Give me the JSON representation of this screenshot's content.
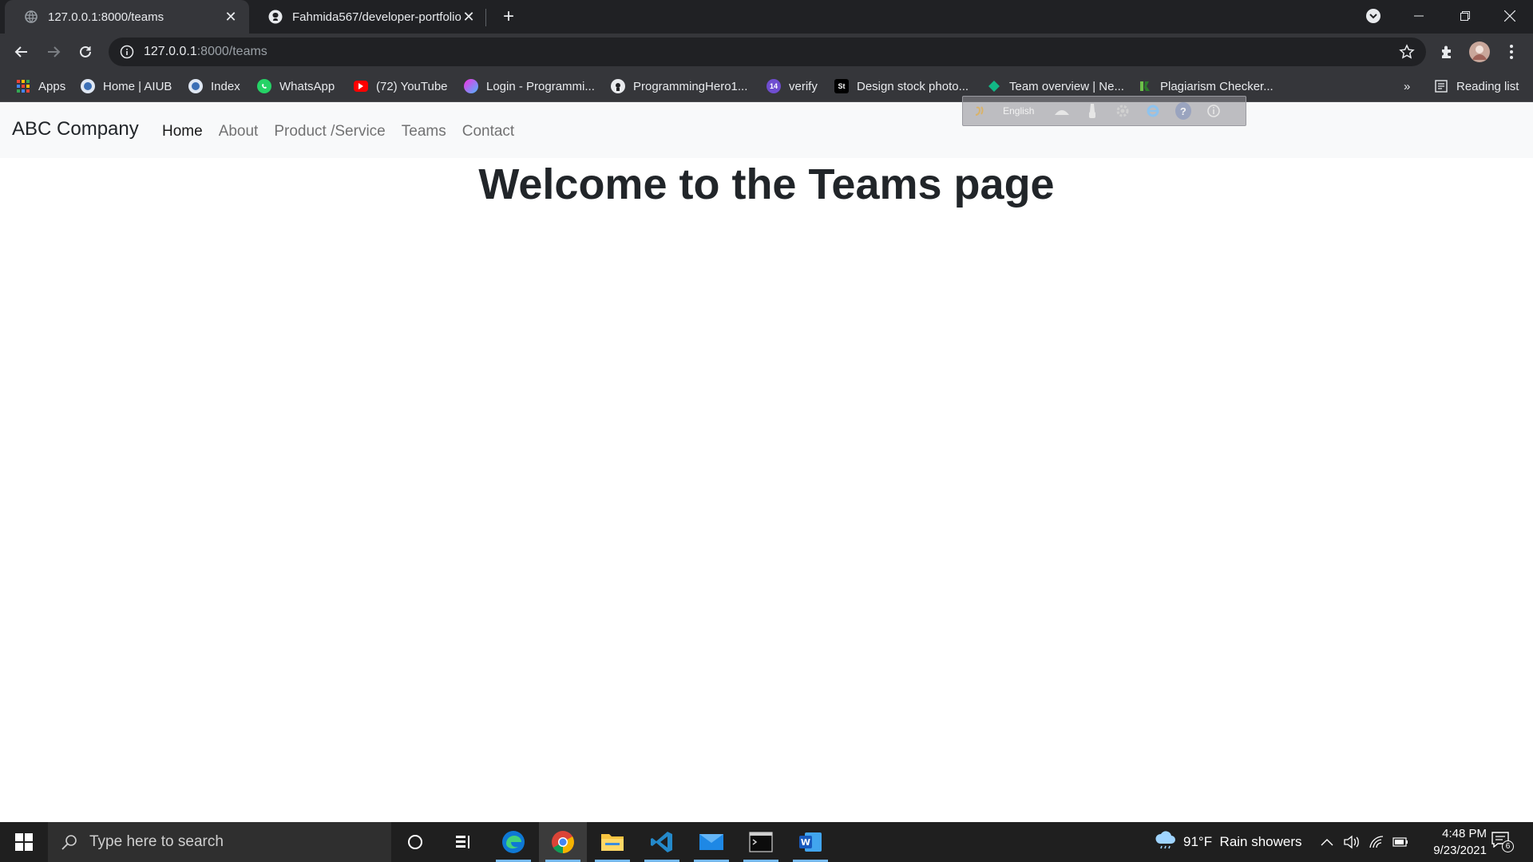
{
  "browser": {
    "tabs": [
      {
        "title": "127.0.0.1:8000/teams",
        "active": true
      },
      {
        "title": "Fahmida567/developer-portfolio",
        "active": false
      }
    ],
    "url": {
      "host": "127.0.0.1",
      "path": ":8000/teams"
    },
    "bookmarks": [
      {
        "label": "Apps",
        "icon": "apps-grid-icon"
      },
      {
        "label": "Home | AIUB",
        "icon": "aiub-icon"
      },
      {
        "label": "Index",
        "icon": "aiub-icon"
      },
      {
        "label": "WhatsApp",
        "icon": "whatsapp-icon"
      },
      {
        "label": "(72) YouTube",
        "icon": "youtube-icon"
      },
      {
        "label": "Login - Programmi...",
        "icon": "programming-hero-icon"
      },
      {
        "label": "ProgrammingHero1...",
        "icon": "github-icon"
      },
      {
        "label": "verify",
        "icon": "verify-icon"
      },
      {
        "label": "Design stock photo...",
        "icon": "shutterstock-icon"
      },
      {
        "label": "Team overview | Ne...",
        "icon": "team-overview-icon"
      },
      {
        "label": "Plagiarism Checker...",
        "icon": "plagiarism-icon"
      }
    ],
    "overflow_label": "»",
    "reading_list_label": "Reading list"
  },
  "page": {
    "brand": "ABC Company",
    "nav": [
      {
        "label": "Home",
        "active": true
      },
      {
        "label": "About",
        "active": false
      },
      {
        "label": "Product /Service",
        "active": false
      },
      {
        "label": "Teams",
        "active": false
      },
      {
        "label": "Contact",
        "active": false
      }
    ],
    "heading": "Welcome to the Teams page",
    "language_bar": {
      "language": "English"
    }
  },
  "taskbar": {
    "search_placeholder": "Type here to search",
    "weather": "91°F  Rain showers",
    "time": "4:48 PM",
    "date": "9/23/2021",
    "notification_count": "6"
  },
  "colors": {
    "chrome_dark": "#202124",
    "chrome_toolbar": "#35363a",
    "navbar_bg": "#f8f9fa",
    "taskbar_bg": "#1f1f1f",
    "accent_blue": "#76b9ed"
  }
}
